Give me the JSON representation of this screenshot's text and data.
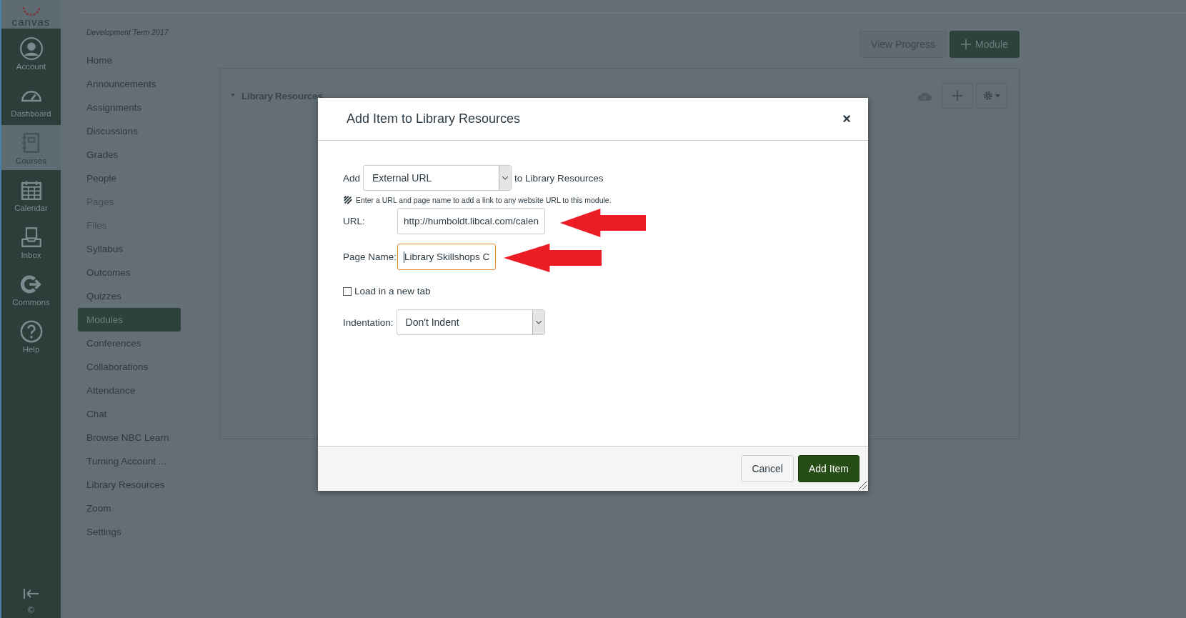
{
  "global_nav": {
    "logo": "canvas",
    "items": [
      {
        "label": "Account",
        "selected": false
      },
      {
        "label": "Dashboard",
        "selected": false
      },
      {
        "label": "Courses",
        "selected": true
      },
      {
        "label": "Calendar",
        "selected": false
      },
      {
        "label": "Inbox",
        "selected": false
      },
      {
        "label": "Commons",
        "selected": false
      },
      {
        "label": "Help",
        "selected": false
      }
    ],
    "footer": "©"
  },
  "course_nav": {
    "term": "Development Term 2017",
    "items": [
      {
        "label": "Home",
        "selected": false,
        "disabled": false
      },
      {
        "label": "Announcements",
        "selected": false,
        "disabled": false
      },
      {
        "label": "Assignments",
        "selected": false,
        "disabled": false
      },
      {
        "label": "Discussions",
        "selected": false,
        "disabled": false
      },
      {
        "label": "Grades",
        "selected": false,
        "disabled": false
      },
      {
        "label": "People",
        "selected": false,
        "disabled": false
      },
      {
        "label": "Pages",
        "selected": false,
        "disabled": true
      },
      {
        "label": "Files",
        "selected": false,
        "disabled": true
      },
      {
        "label": "Syllabus",
        "selected": false,
        "disabled": false
      },
      {
        "label": "Outcomes",
        "selected": false,
        "disabled": false
      },
      {
        "label": "Quizzes",
        "selected": false,
        "disabled": false
      },
      {
        "label": "Modules",
        "selected": true,
        "disabled": false
      },
      {
        "label": "Conferences",
        "selected": false,
        "disabled": false
      },
      {
        "label": "Collaborations",
        "selected": false,
        "disabled": false
      },
      {
        "label": "Attendance",
        "selected": false,
        "disabled": false
      },
      {
        "label": "Chat",
        "selected": false,
        "disabled": false
      },
      {
        "label": "Browse NBC Learn",
        "selected": false,
        "disabled": false
      },
      {
        "label": "Turning Account ...",
        "selected": false,
        "disabled": false
      },
      {
        "label": "Library Resources",
        "selected": false,
        "disabled": false
      },
      {
        "label": "Zoom",
        "selected": false,
        "disabled": false
      },
      {
        "label": "Settings",
        "selected": false,
        "disabled": false
      }
    ]
  },
  "header_buttons": [
    {
      "label": "View Progress",
      "kind": "secondary"
    },
    {
      "label": "Module",
      "kind": "primary"
    }
  ],
  "module": {
    "title": "Library Resources",
    "expanded": true
  },
  "dialog": {
    "title": "Add Item to Library Resources",
    "close": "×",
    "add_label": "Add",
    "type_select": "External URL",
    "to_label": "to Library Resources",
    "hint": "Enter a URL and page name to add a link to any website URL to this module.",
    "fields": [
      {
        "label": "URL:",
        "value": "http://humboldt.libcal.com/calen",
        "focused": false
      },
      {
        "label": "Page Name:",
        "value": "Library Skillshops C",
        "focused": true
      }
    ],
    "new_tab": {
      "label": "Load in a new tab",
      "checked": false
    },
    "indentation": {
      "label": "Indentation:",
      "value": "Don't Indent"
    },
    "buttons": [
      {
        "label": "Cancel",
        "kind": "secondary"
      },
      {
        "label": "Add Item",
        "kind": "primary"
      }
    ]
  }
}
